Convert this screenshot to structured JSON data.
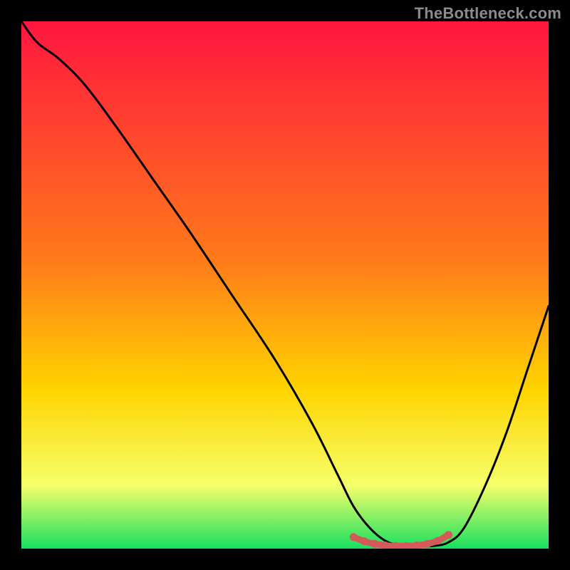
{
  "watermark": "TheBottleneck.com",
  "colors": {
    "background": "#000000",
    "gradient_top": "#ff163f",
    "gradient_mid": "#ffd400",
    "gradient_low": "#f6ff6a",
    "gradient_bottom": "#18e060",
    "curve": "#000000",
    "marker_stroke": "#d45a5a",
    "marker_fill": "#d45a5a"
  },
  "chart_data": {
    "type": "line",
    "title": "",
    "xlabel": "",
    "ylabel": "",
    "xlim": [
      0,
      100
    ],
    "ylim": [
      0,
      100
    ],
    "grid": false,
    "legend": false,
    "series": [
      {
        "name": "bottleneck-curve",
        "x": [
          0,
          3,
          7,
          12,
          18,
          25,
          32,
          40,
          48,
          55,
          60,
          63,
          66,
          69,
          72,
          75,
          78,
          81,
          84,
          88,
          92,
          96,
          100
        ],
        "y": [
          100,
          96,
          93,
          88,
          80,
          70,
          60,
          48,
          36,
          24,
          14,
          8,
          4,
          1.5,
          0.6,
          0.4,
          0.5,
          1.2,
          4,
          12,
          22,
          34,
          46
        ]
      }
    ],
    "highlight_segment": {
      "name": "optimal-range",
      "x": [
        63,
        65,
        67,
        69,
        71,
        73,
        75,
        77,
        79,
        81
      ],
      "y": [
        2.2,
        1.4,
        0.9,
        0.6,
        0.5,
        0.5,
        0.6,
        0.9,
        1.5,
        2.6
      ]
    }
  }
}
